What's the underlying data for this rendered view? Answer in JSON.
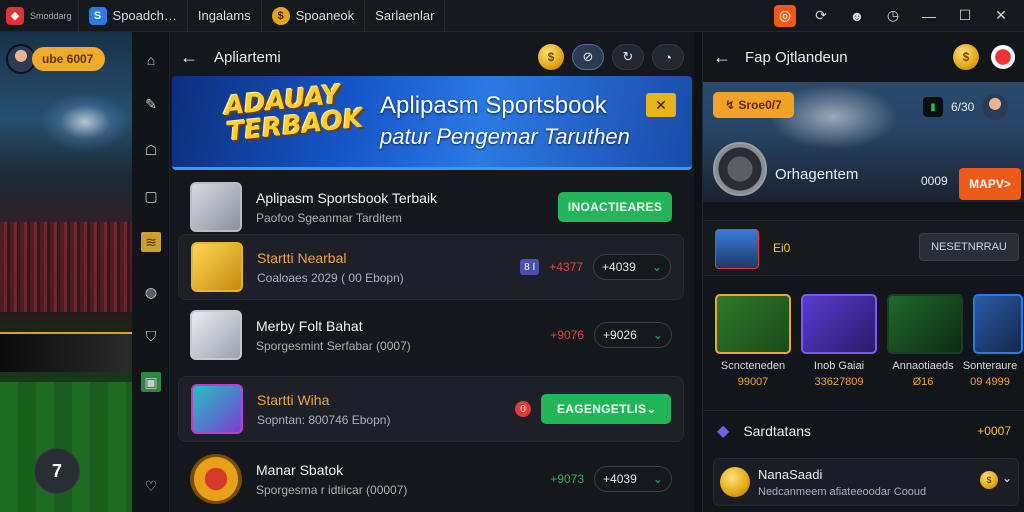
{
  "titlebar": {
    "tabs": [
      {
        "label": "Spoadch…",
        "icon": "app-icon"
      },
      {
        "label": "Ingalams",
        "icon": ""
      },
      {
        "label": "Spoaneok",
        "icon": "coin-icon"
      },
      {
        "label": "Sarlaenlar",
        "icon": ""
      }
    ],
    "app_badge": "Smoddarg",
    "controls": [
      "minimize",
      "maximize",
      "close"
    ]
  },
  "left": {
    "balance": "ube 6007",
    "fab_label": "7"
  },
  "center": {
    "title": "Apliartemi",
    "banner": {
      "logo_line1": "ADAUAY",
      "logo_line2": "TERBAOK",
      "headline": "Aplipasm Sportsbook",
      "subline": "patur Pengemar Taruthen"
    },
    "featured": {
      "title": "Aplipasm Sportsbook Terbaik",
      "subtitle": "Paofoo Sgeanmar Tarditem",
      "button": "INOACTIEARES"
    },
    "rows": [
      {
        "title": "Startti Nearbal",
        "subtitle": "Coaloaes 2029 ( 00 Ebopn)",
        "badge": "8 I",
        "odd": "+4377",
        "box": "+4039"
      },
      {
        "title": "Merby Folt Bahat",
        "subtitle": "Sporgesmint Serfabar (0007)",
        "odd": "+9076",
        "box": "+9026"
      },
      {
        "title": "Startti Wiha",
        "subtitle": "Sopntan: 800746 Ebopn)",
        "red": "0",
        "button": "EAGENGETLIS"
      },
      {
        "title": "Manar Sbatok",
        "subtitle": "Sporgesma r idtiicar (00007)",
        "odd": "+9073",
        "box": "+4039"
      }
    ]
  },
  "right": {
    "title": "Fap Ojtlandeun",
    "hero": {
      "pill": "↯ Sroe0/7",
      "count": "6/30",
      "name": "Orhagentem",
      "value": "0009",
      "button": "MAPV>"
    },
    "promo": {
      "label": "Ei0",
      "button": "NESETNRRAU"
    },
    "cards": [
      {
        "label": "Scncteneden",
        "value": "99007"
      },
      {
        "label": "Inob Gaiai",
        "value": "33627809"
      },
      {
        "label": "Annaotiaeds",
        "value": "Ø16"
      },
      {
        "label": "Sonteraure",
        "value": "09 4999"
      }
    ],
    "section": {
      "title": "Sardtatans",
      "value": "+0007"
    },
    "item": {
      "title": "NanaSaadi",
      "subtitle": "Nedcanmeem afiateeoodar Cooud"
    }
  }
}
